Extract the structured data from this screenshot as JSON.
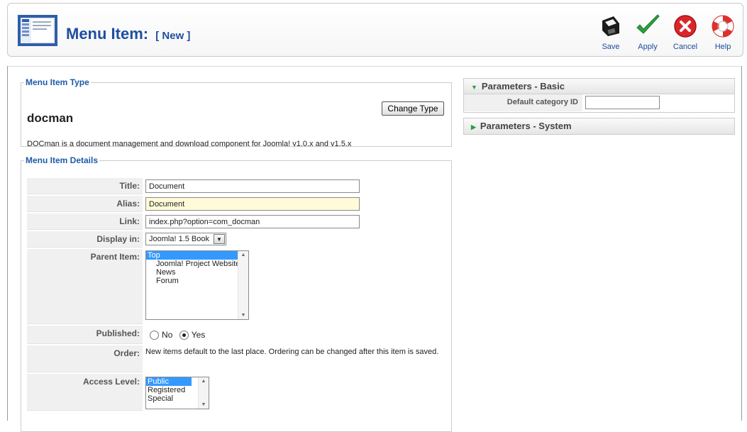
{
  "header": {
    "title": "Menu Item:",
    "subtitle": "[ New ]",
    "buttons": [
      {
        "label": "Save",
        "icon": "save-icon"
      },
      {
        "label": "Apply",
        "icon": "apply-icon"
      },
      {
        "label": "Cancel",
        "icon": "cancel-icon"
      },
      {
        "label": "Help",
        "icon": "help-icon"
      }
    ]
  },
  "menu_item_type": {
    "legend": "Menu Item Type",
    "name": "docman",
    "change_button": "Change Type",
    "description": "DOCman is a document management and download component for Joomla! v1.0.x and v1.5.x"
  },
  "details": {
    "legend": "Menu Item Details",
    "title_label": "Title:",
    "title_value": "Document",
    "alias_label": "Alias:",
    "alias_value": "Document",
    "link_label": "Link:",
    "link_value": "index.php?option=com_docman",
    "display_label": "Display in:",
    "display_value": "Joomla! 1.5 Book",
    "parent_label": "Parent Item:",
    "parent_options": [
      "Top",
      "Joomla! Project Website",
      "News",
      "Forum"
    ],
    "parent_selected": "Top",
    "published_label": "Published:",
    "published_no": "No",
    "published_yes": "Yes",
    "published_value": "Yes",
    "order_label": "Order:",
    "order_text": "New items default to the last place. Ordering can be changed after this item is saved.",
    "access_label": "Access Level:",
    "access_options": [
      "Public",
      "Registered",
      "Special"
    ],
    "access_selected": "Public"
  },
  "params_basic": {
    "title": "Parameters - Basic",
    "field_label": "Default category ID",
    "field_value": ""
  },
  "params_system": {
    "title": "Parameters - System"
  },
  "colors": {
    "title_blue": "#1f4fa0",
    "legend_blue": "#1e5aa8",
    "selection": "#3399ff",
    "alias_bg": "#fffbd8"
  }
}
